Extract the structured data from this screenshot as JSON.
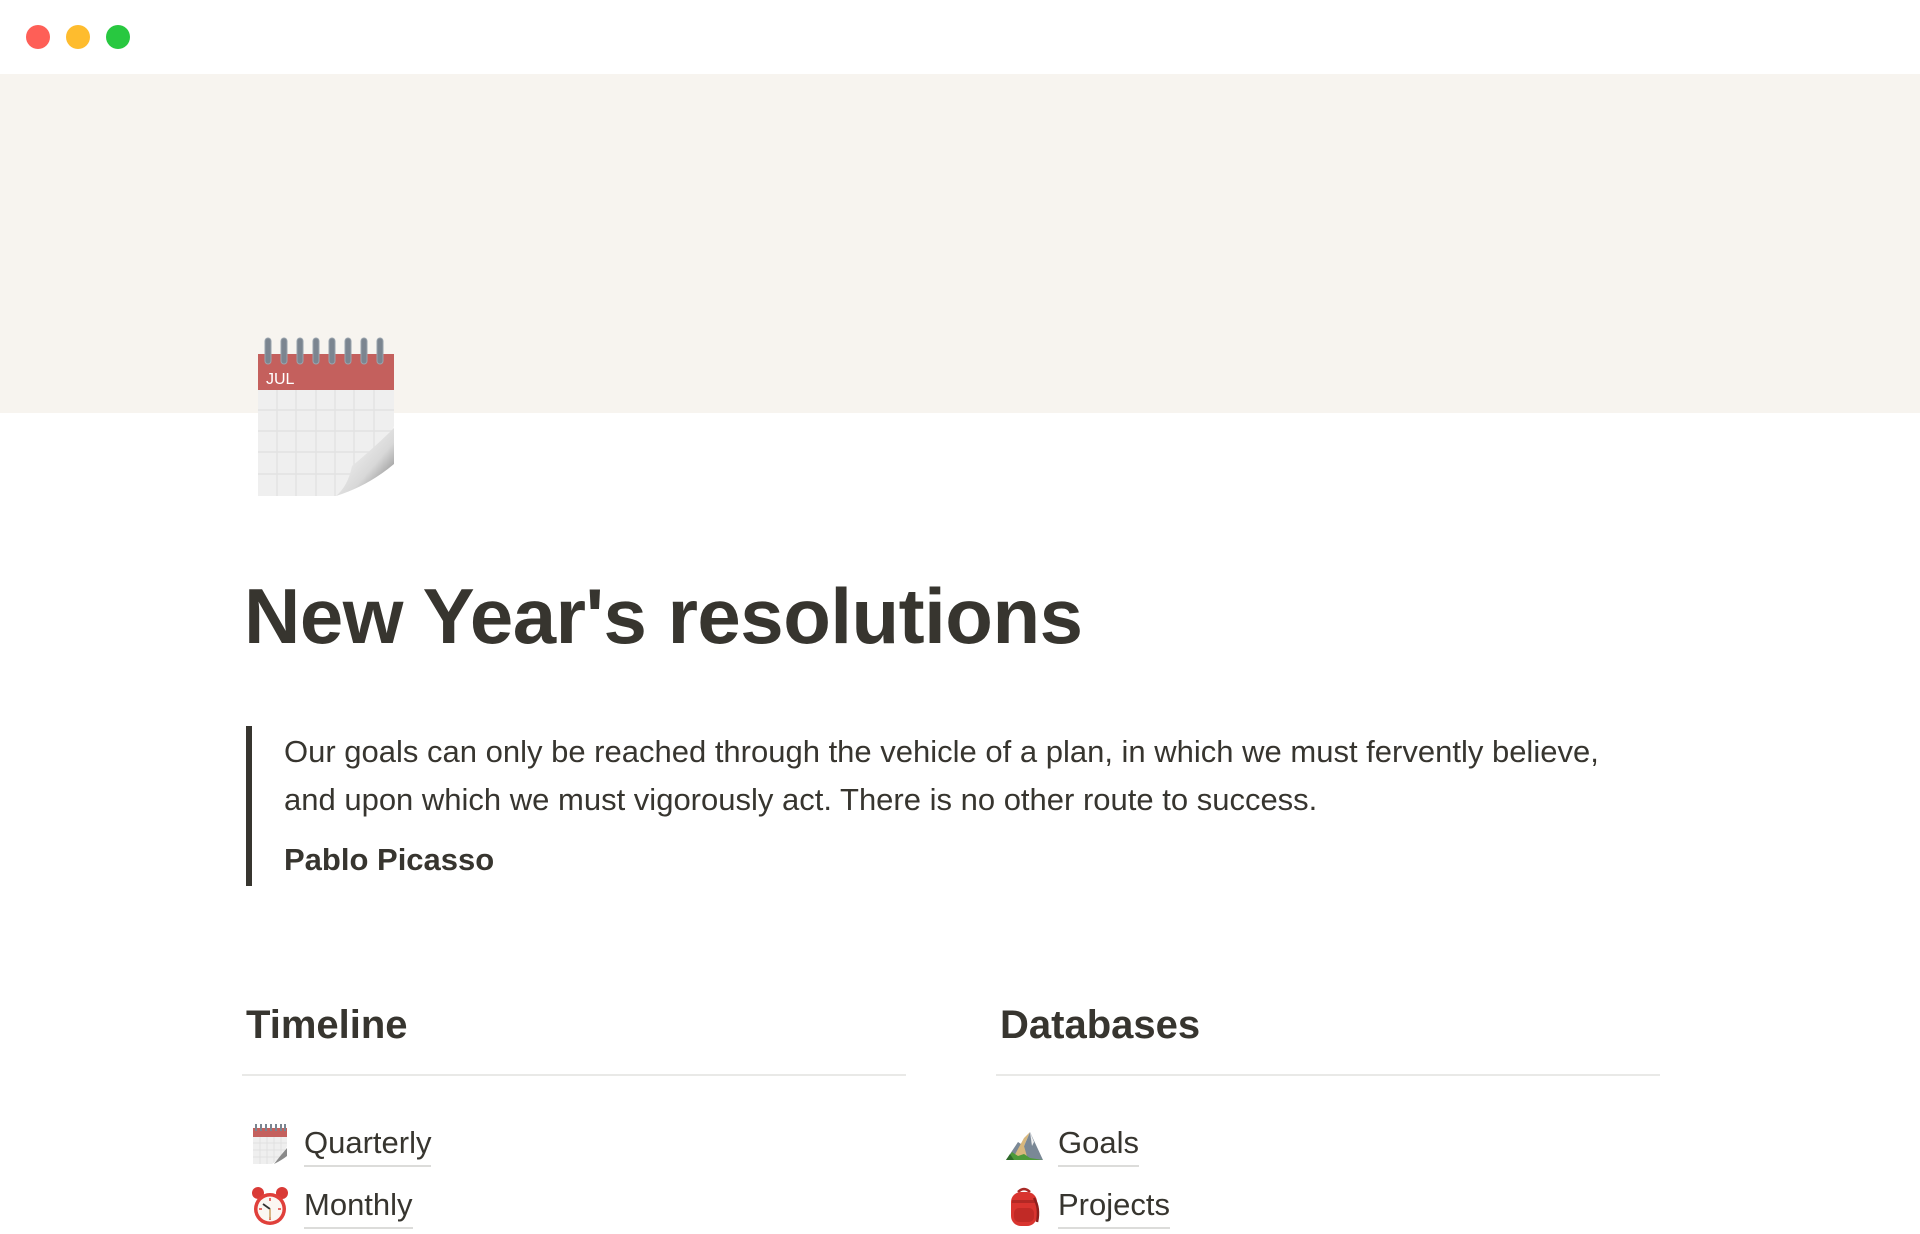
{
  "window": {
    "controls": [
      "close",
      "minimize",
      "maximize"
    ],
    "colors": {
      "close": "#fe5f57",
      "minimize": "#febc2e",
      "maximize": "#28c840"
    }
  },
  "cover": {
    "color": "#f7f4ef"
  },
  "page": {
    "icon": "calendar-icon",
    "icon_month": "JUL",
    "title": "New Year's resolutions"
  },
  "quote": {
    "text": "Our goals can only be reached through the vehicle of a plan, in which we must fervently believe, and upon which we must vigorously act. There is no other route to success.",
    "author": "Pablo Picasso"
  },
  "columns": {
    "timeline": {
      "heading": "Timeline",
      "items": [
        {
          "label": "Quarterly",
          "icon": "calendar-icon"
        },
        {
          "label": "Monthly",
          "icon": "alarm-clock-icon"
        }
      ]
    },
    "databases": {
      "heading": "Databases",
      "items": [
        {
          "label": "Goals",
          "icon": "mountain-icon"
        },
        {
          "label": "Projects",
          "icon": "backpack-icon"
        }
      ]
    }
  }
}
